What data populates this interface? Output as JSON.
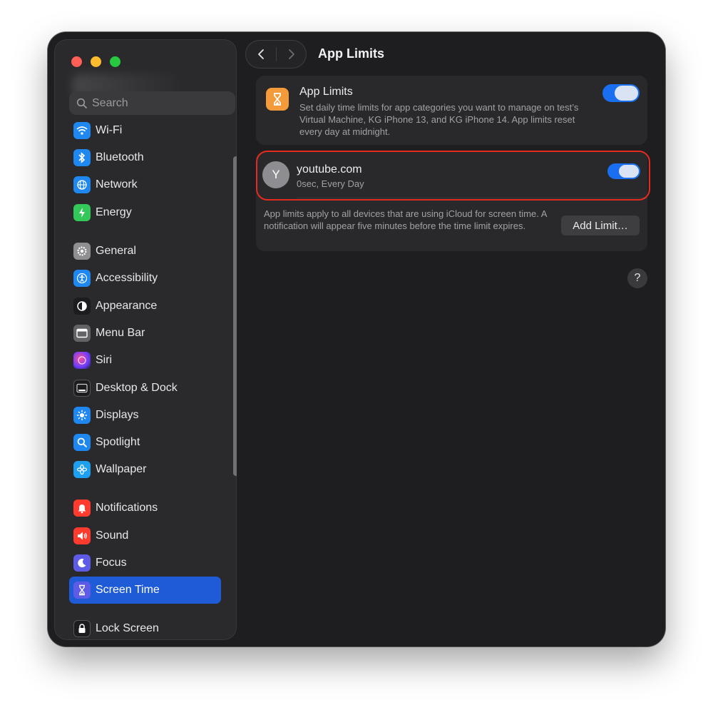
{
  "sidebar": {
    "search_placeholder": "Search",
    "items": [
      {
        "label": "Wi-Fi",
        "icon": "wifi-icon",
        "color": "#1e87f0"
      },
      {
        "label": "Bluetooth",
        "icon": "bluetooth-icon",
        "color": "#1e87f0"
      },
      {
        "label": "Network",
        "icon": "globe-icon",
        "color": "#1e87f0"
      },
      {
        "label": "Energy",
        "icon": "bolt-icon",
        "color": "#34c759"
      },
      {
        "label": "General",
        "icon": "gear-icon",
        "color": "#8e8e93"
      },
      {
        "label": "Accessibility",
        "icon": "accessibility-icon",
        "color": "#1e87f0"
      },
      {
        "label": "Appearance",
        "icon": "appearance-icon",
        "color": "#1c1c1e"
      },
      {
        "label": "Menu Bar",
        "icon": "menubar-icon",
        "color": "#636366"
      },
      {
        "label": "Siri",
        "icon": "siri-icon",
        "color": "#5856d6"
      },
      {
        "label": "Desktop & Dock",
        "icon": "dock-icon",
        "color": "#1c1c1e"
      },
      {
        "label": "Displays",
        "icon": "sun-icon",
        "color": "#1e87f0"
      },
      {
        "label": "Spotlight",
        "icon": "magnifier-icon",
        "color": "#1e87f0"
      },
      {
        "label": "Wallpaper",
        "icon": "flower-icon",
        "color": "#1ea0f0"
      },
      {
        "label": "Notifications",
        "icon": "bell-icon",
        "color": "#ff3b30"
      },
      {
        "label": "Sound",
        "icon": "speaker-icon",
        "color": "#ff3b30"
      },
      {
        "label": "Focus",
        "icon": "moon-icon",
        "color": "#5e5ce6"
      },
      {
        "label": "Screen Time",
        "icon": "hourglass-icon",
        "color": "#5e5ce6"
      },
      {
        "label": "Lock Screen",
        "icon": "lock-icon",
        "color": "#1c1c1e"
      }
    ],
    "selected": "Screen Time"
  },
  "toolbar": {
    "title": "App Limits"
  },
  "app_limits_card": {
    "title": "App Limits",
    "description": "Set daily time limits for app categories you want to manage on test’s Virtual Machine, KG iPhone 13, and KG iPhone 14. App limits reset every day at midnight.",
    "toggle_on": true
  },
  "limits": [
    {
      "avatar_letter": "Y",
      "name": "youtube.com",
      "detail": "0sec, Every Day",
      "toggle_on": true
    }
  ],
  "footer": {
    "text": "App limits apply to all devices that are using iCloud for screen time. A notification will appear five minutes before the time limit expires.",
    "add_button": "Add Limit…"
  },
  "help_label": "?"
}
